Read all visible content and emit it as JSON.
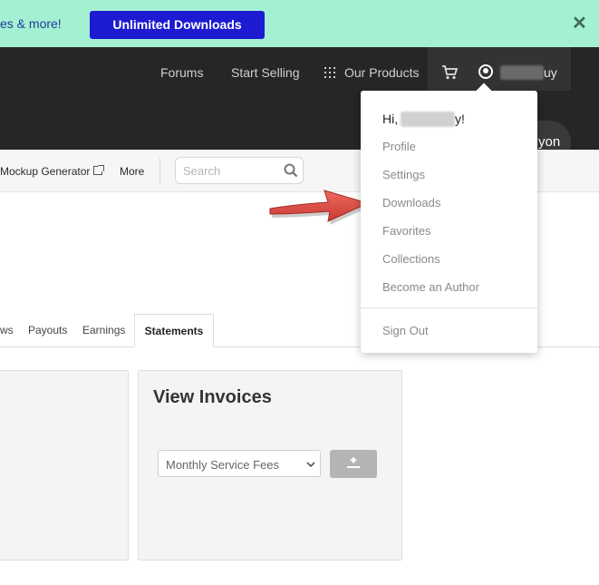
{
  "promo": {
    "text": "es & more!",
    "button_label": "Unlimited Downloads",
    "close_symbol": "✕"
  },
  "header": {
    "nav": [
      "Forums",
      "Start Selling",
      "Our Products"
    ],
    "user_name_visible_suffix": "uy",
    "pill_text": "yon"
  },
  "subnav": {
    "mockup_label": "Mockup Generator",
    "more_label": "More",
    "search_placeholder": "Search"
  },
  "tabs": {
    "items": [
      "ws",
      "Payouts",
      "Earnings"
    ],
    "active": "Statements"
  },
  "invoices": {
    "title": "View Invoices",
    "select_value": "Monthly Service Fees"
  },
  "user_menu": {
    "greeting_prefix": "Hi,",
    "greeting_suffix": "y!",
    "items": [
      "Profile",
      "Settings",
      "Downloads",
      "Favorites",
      "Collections",
      "Become an Author"
    ],
    "sign_out": "Sign Out"
  },
  "colors": {
    "promo_bg": "#a3f0d3",
    "promo_button": "#1d1bd1",
    "header_bg": "#262626",
    "arrow": "#d9483e"
  },
  "icons": {
    "cart": "cart-icon",
    "user": "user-circle-icon",
    "search": "search-icon",
    "download": "download-icon",
    "external": "external-link-icon",
    "grid": "grid-dots-icon"
  }
}
